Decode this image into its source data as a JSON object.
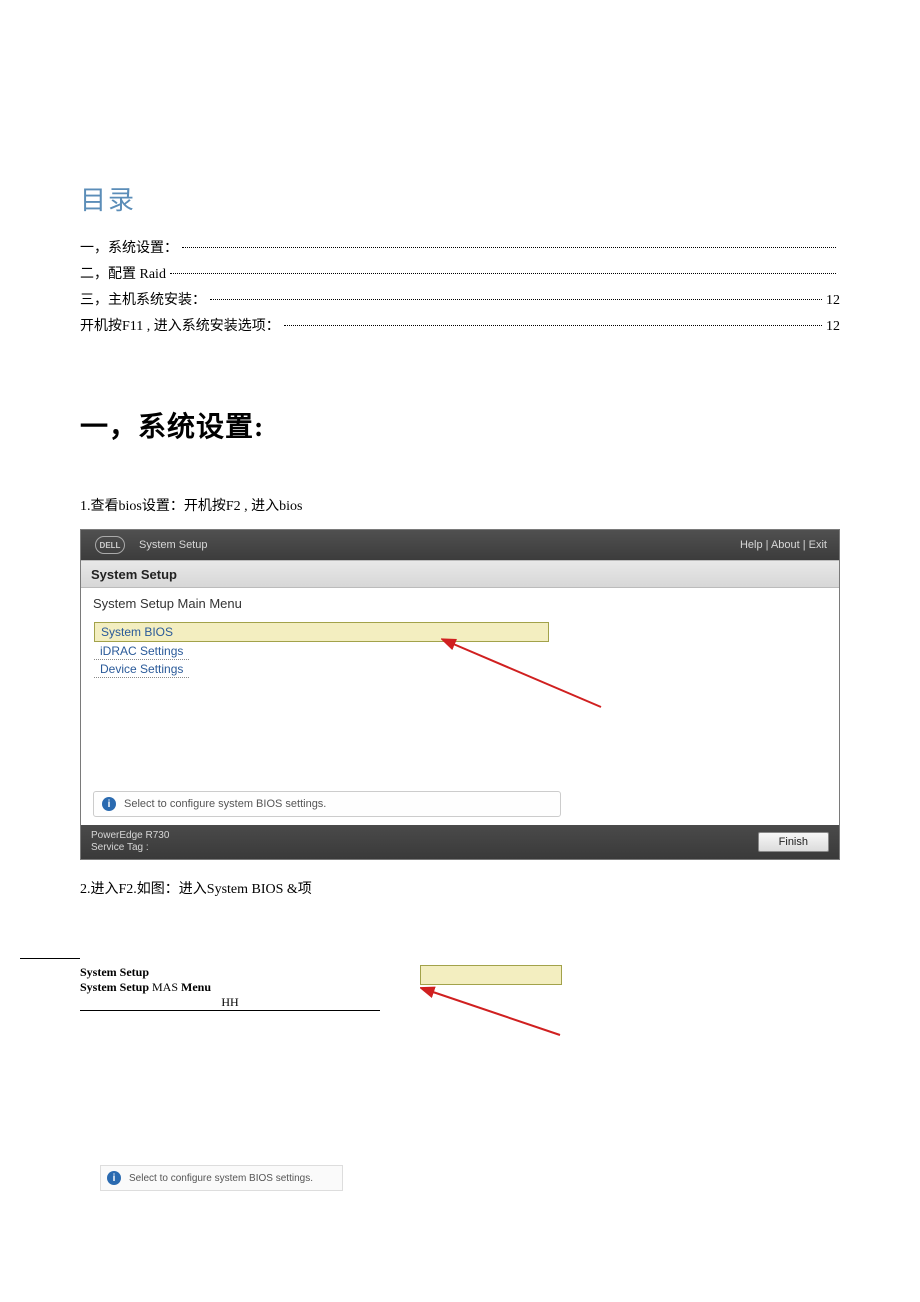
{
  "toc": {
    "title": "目录",
    "items": [
      {
        "label": "一，系统设置：",
        "page": ""
      },
      {
        "label": "二，配置  Raid",
        "page": ""
      },
      {
        "label": "三，主机系统安装：",
        "page": "12"
      },
      {
        "label": "开机按F11 , 进入系统安装选项：",
        "page": "12"
      }
    ]
  },
  "section1": {
    "heading": "一，系统设置:",
    "step1": "1.查看bios设置：开机按F2 , 进入bios",
    "step2": "2.进入F2.如图：进入System BIOS &项"
  },
  "bios": {
    "top_title": "System Setup",
    "top_links": "Help | About | Exit",
    "panel_title": "System Setup",
    "menu_label": "System Setup Main Menu",
    "items": {
      "bios": "System BIOS",
      "idrac": "iDRAC Settings",
      "device": "Device Settings"
    },
    "hint": "Select to configure system BIOS settings.",
    "model_line1": "PowerEdge R730",
    "model_line2": "Service Tag :",
    "finish": "Finish"
  },
  "small": {
    "line1": "System Setup",
    "line2a": "System Setup ",
    "line2b": "MAS",
    "line2c": " Menu",
    "line3": "HH",
    "hint": "Select to configure system BIOS settings."
  }
}
